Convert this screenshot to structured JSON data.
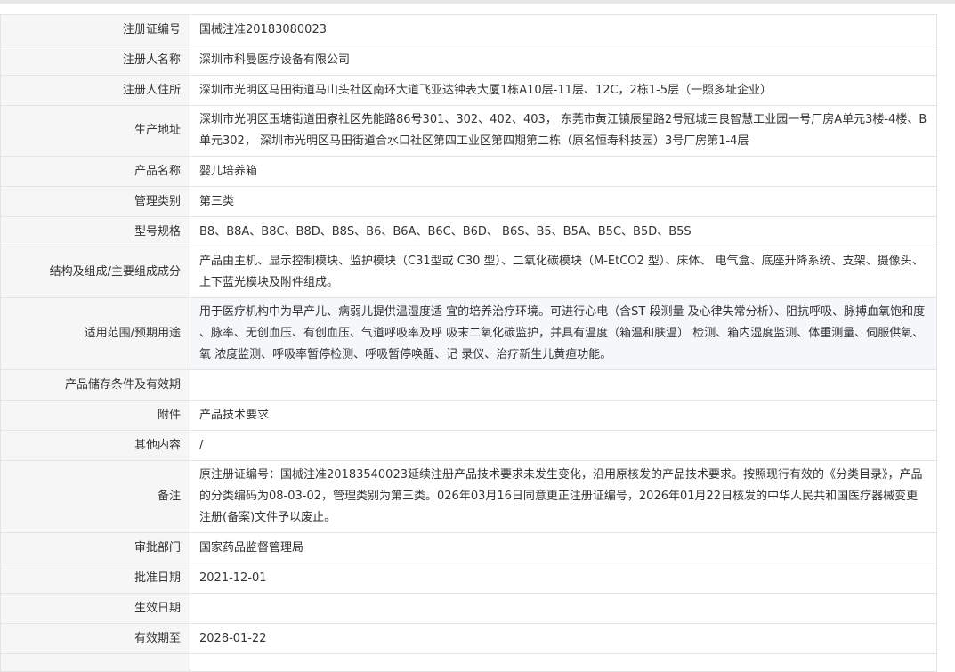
{
  "rows": [
    {
      "label": "注册证编号",
      "value": "国械注准20183080023"
    },
    {
      "label": "注册人名称",
      "value": "深圳市科曼医疗设备有限公司"
    },
    {
      "label": "注册人住所",
      "value": "深圳市光明区马田街道马山头社区南环大道飞亚达钟表大厦1栋A10层-11层、12C，2栋1-5层（一照多址企业）"
    },
    {
      "label": "生产地址",
      "value": "深圳市光明区玉塘街道田寮社区先能路86号301、302、402、403， 东莞市黄江镇辰星路2号冠城三良智慧工业园一号厂房A单元3楼-4楼、B单元302， 深圳市光明区马田街道合水口社区第四工业区第四期第二栋（原名恒寿科技园）3号厂房第1-4层"
    },
    {
      "label": "产品名称",
      "value": "婴儿培养箱"
    },
    {
      "label": "管理类别",
      "value": "第三类"
    },
    {
      "label": "型号规格",
      "value": "B8、B8A、B8C、B8D、B8S、B6、B6A、B6C、B6D、 B6S、B5、B5A、B5C、B5D、B5S"
    },
    {
      "label": "结构及组成/主要组成成分",
      "value": "产品由主机、显示控制模块、监护模块（C31型或 C30 型）、二氧化碳模块（M-EtCO2 型）、床体、 电气盒、底座升降系统、支架、摄像头、上下蓝光模块及附件组成。"
    },
    {
      "label": "适用范围/预期用途",
      "value": "用于医疗机构中为早产儿、病弱儿提供温湿度适 宜的培养治疗环境。可进行心电（含ST 段测量 及心律失常分析）、阻抗呼吸、脉搏血氧饱和度 、脉率、无创血压、有创血压、气道呼吸率及呼 吸末二氧化碳监护，并具有温度（箱温和肤温） 检测、箱内湿度监测、体重测量、伺服供氧、氧 浓度监测、呼吸率暂停检测、呼吸暂停唤醒、记 录仪、治疗新生儿黄疸功能。"
    },
    {
      "label": "产品储存条件及有效期",
      "value": ""
    },
    {
      "label": "附件",
      "value": "产品技术要求"
    },
    {
      "label": "其他内容",
      "value": "/"
    },
    {
      "label": "备注",
      "value": "原注册证编号：国械注准20183540023延续注册产品技术要求未发生变化，沿用原核发的产品技术要求。按照现行有效的《分类目录》，产品的分类编码为08-03-02，管理类别为第三类。026年03月16日同意更正注册证编号，2026年01月22日核发的中华人民共和国医疗器械变更注册(备案)文件予以废止。"
    },
    {
      "label": "审批部门",
      "value": "国家药品监督管理局"
    },
    {
      "label": "批准日期",
      "value": "2021-12-01"
    },
    {
      "label": "生效日期",
      "value": ""
    },
    {
      "label": "有效期至",
      "value": "2028-01-22"
    }
  ]
}
